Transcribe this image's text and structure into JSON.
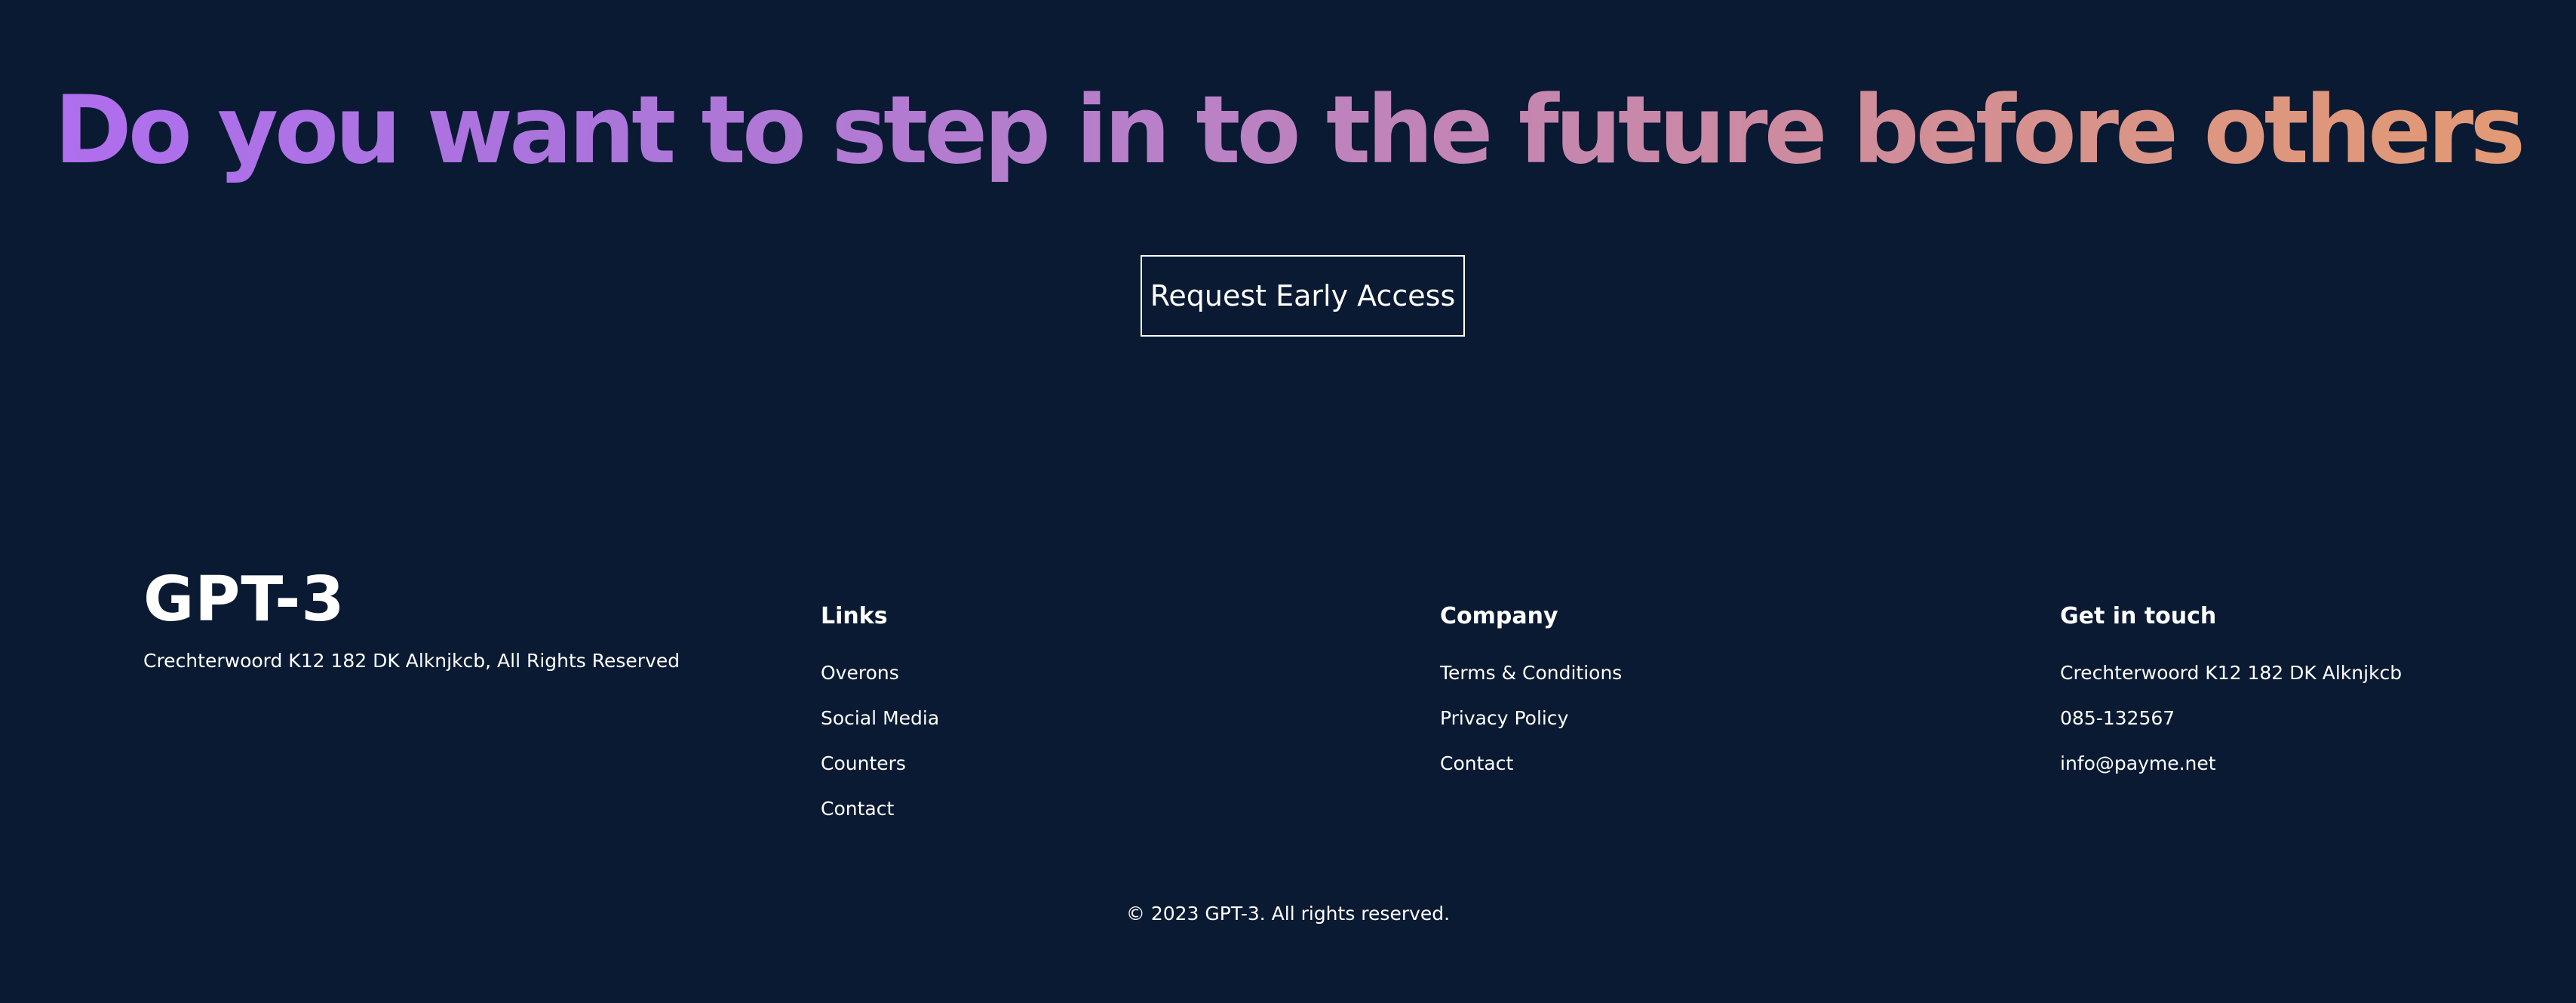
{
  "hero": {
    "headline": "Do you want to step in to the future before others",
    "cta_label": "Request Early Access"
  },
  "footer": {
    "brand": {
      "logo": "GPT-3",
      "address": "Crechterwoord K12 182 DK Alknjkcb, All Rights Reserved"
    },
    "columns": [
      {
        "heading": "Links",
        "items": [
          "Overons",
          "Social Media",
          "Counters",
          "Contact"
        ]
      },
      {
        "heading": "Company",
        "items": [
          "Terms & Conditions",
          "Privacy Policy",
          "Contact"
        ]
      },
      {
        "heading": "Get in touch",
        "items": [
          "Crechterwoord K12 182 DK Alknjkcb",
          "085-132567",
          "info@payme.net"
        ]
      }
    ],
    "copyright": "© 2023 GPT-3. All rights reserved."
  },
  "colors": {
    "background": "#0a1a33",
    "text": "#ffffff",
    "headline_gradient": [
      "#b06ef0",
      "#ab74dc",
      "#b880c8",
      "#cc8aa2",
      "#dc9682",
      "#e49a72"
    ]
  }
}
